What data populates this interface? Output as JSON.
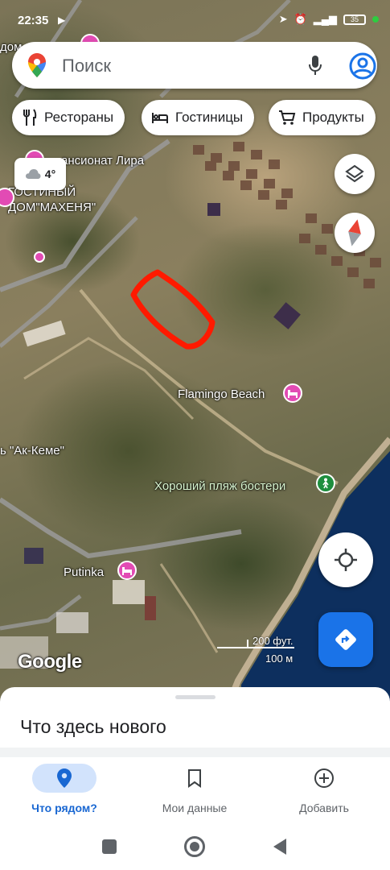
{
  "status_bar": {
    "time": "22:35",
    "battery": "35"
  },
  "search": {
    "placeholder": "Поиск"
  },
  "chips": [
    {
      "label": "Рестораны",
      "icon": "fork-knife-icon"
    },
    {
      "label": "Гостиницы",
      "icon": "bed-icon"
    },
    {
      "label": "Продукты",
      "icon": "cart-icon"
    }
  ],
  "weather": {
    "temp": "4°",
    "icon": "cloud-icon"
  },
  "map_labels": {
    "pansionat": "ансионат Лира",
    "gostiny_line1": "ГОСТИНЫЙ",
    "gostiny_line2": "ДОМ\"МАХЕНЯ\"",
    "ak_keme": "ь \"Ак-Кеме\"",
    "flamingo": "Flamingo Beach",
    "horoshiy": "Хороший пляж бостери",
    "putinka": "Putinka",
    "partial_top": "дом"
  },
  "scale": {
    "imperial": "200 фут.",
    "metric": "100 м"
  },
  "google_logo": "Google",
  "sheet": {
    "title": "Что здесь нового"
  },
  "bottom_nav": [
    {
      "label": "Что рядом?",
      "active": true
    },
    {
      "label": "Мои данные",
      "active": false
    },
    {
      "label": "Добавить",
      "active": false
    }
  ],
  "colors": {
    "accent": "#1a73e8",
    "poi_hotel": "#e24bb4",
    "poi_park": "#1e8e3e",
    "annotation": "#ff1a00"
  }
}
